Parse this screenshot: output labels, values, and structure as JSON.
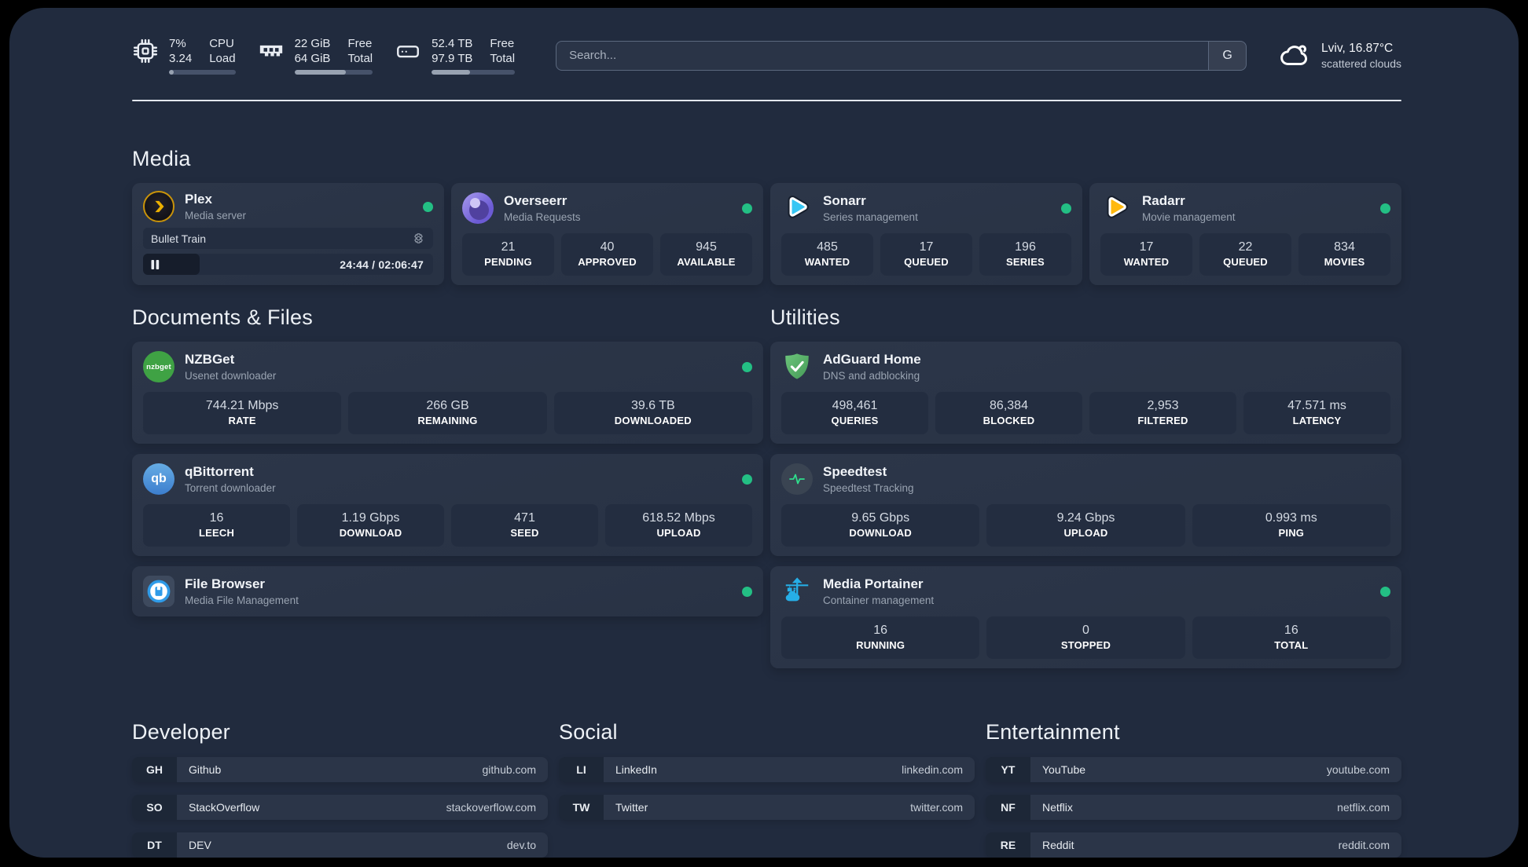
{
  "colors": {
    "page_bg": "#212B3E",
    "card_bg": "#2A3447",
    "status_online": "#23BF84"
  },
  "topbar": {
    "stats": [
      {
        "icon": "cpu-icon",
        "values": [
          "7%",
          "3.24"
        ],
        "labels": [
          "CPU",
          "Load"
        ],
        "progress": "7%"
      },
      {
        "icon": "memory-icon",
        "values": [
          "22 GiB",
          "64 GiB"
        ],
        "labels": [
          "Free",
          "Total"
        ],
        "progress": "66%"
      },
      {
        "icon": "disk-icon",
        "values": [
          "52.4 TB",
          "97.9 TB"
        ],
        "labels": [
          "Free",
          "Total"
        ],
        "progress": "46%"
      }
    ],
    "search": {
      "placeholder": "Search...",
      "engine": "G"
    },
    "weather": {
      "icon": "cloud-icon",
      "summary": "Lviv, 16.87°C",
      "condition": "scattered clouds"
    }
  },
  "media": {
    "title": "Media",
    "plex": {
      "name": "Plex",
      "desc": "Media server",
      "icon": "plex-icon",
      "online": true,
      "now_playing": {
        "title": "Bullet Train",
        "time": "24:44 / 02:06:47",
        "progress": "19.5%"
      }
    },
    "overseerr": {
      "name": "Overseerr",
      "desc": "Media Requests",
      "icon": "overseerr-icon",
      "online": true,
      "stats": [
        {
          "value": "21",
          "label": "PENDING"
        },
        {
          "value": "40",
          "label": "APPROVED"
        },
        {
          "value": "945",
          "label": "AVAILABLE"
        }
      ]
    },
    "sonarr": {
      "name": "Sonarr",
      "desc": "Series management",
      "icon": "sonarr-icon",
      "online": true,
      "stats": [
        {
          "value": "485",
          "label": "WANTED"
        },
        {
          "value": "17",
          "label": "QUEUED"
        },
        {
          "value": "196",
          "label": "SERIES"
        }
      ]
    },
    "radarr": {
      "name": "Radarr",
      "desc": "Movie management",
      "icon": "radarr-icon",
      "online": true,
      "stats": [
        {
          "value": "17",
          "label": "WANTED"
        },
        {
          "value": "22",
          "label": "QUEUED"
        },
        {
          "value": "834",
          "label": "MOVIES"
        }
      ]
    }
  },
  "documents": {
    "title": "Documents & Files",
    "nzbget": {
      "name": "NZBGet",
      "desc": "Usenet downloader",
      "icon": "nzbget-icon",
      "icon_text": "nzbget",
      "online": true,
      "stats": [
        {
          "value": "744.21 Mbps",
          "label": "RATE"
        },
        {
          "value": "266 GB",
          "label": "REMAINING"
        },
        {
          "value": "39.6 TB",
          "label": "DOWNLOADED"
        }
      ]
    },
    "qbittorrent": {
      "name": "qBittorrent",
      "desc": "Torrent downloader",
      "icon": "qbittorrent-icon",
      "icon_text": "qb",
      "online": true,
      "stats": [
        {
          "value": "16",
          "label": "LEECH"
        },
        {
          "value": "1.19 Gbps",
          "label": "DOWNLOAD"
        },
        {
          "value": "471",
          "label": "SEED"
        },
        {
          "value": "618.52 Mbps",
          "label": "UPLOAD"
        }
      ]
    },
    "filebrowser": {
      "name": "File Browser",
      "desc": "Media File Management",
      "icon": "filebrowser-icon",
      "online": true
    }
  },
  "utilities": {
    "title": "Utilities",
    "adguard": {
      "name": "AdGuard Home",
      "desc": "DNS and adblocking",
      "icon": "adguard-icon",
      "stats": [
        {
          "value": "498,461",
          "label": "QUERIES"
        },
        {
          "value": "86,384",
          "label": "BLOCKED"
        },
        {
          "value": "2,953",
          "label": "FILTERED"
        },
        {
          "value": "47.571 ms",
          "label": "LATENCY"
        }
      ]
    },
    "speedtest": {
      "name": "Speedtest",
      "desc": "Speedtest Tracking",
      "icon": "speedtest-icon",
      "stats": [
        {
          "value": "9.65 Gbps",
          "label": "DOWNLOAD"
        },
        {
          "value": "9.24 Gbps",
          "label": "UPLOAD"
        },
        {
          "value": "0.993 ms",
          "label": "PING"
        }
      ]
    },
    "portainer": {
      "name": "Media Portainer",
      "desc": "Container management",
      "icon": "portainer-icon",
      "online": true,
      "stats": [
        {
          "value": "16",
          "label": "RUNNING"
        },
        {
          "value": "0",
          "label": "STOPPED"
        },
        {
          "value": "16",
          "label": "TOTAL"
        }
      ]
    }
  },
  "bookmarks": {
    "developer": {
      "title": "Developer",
      "items": [
        {
          "abbr": "GH",
          "name": "Github",
          "url": "github.com"
        },
        {
          "abbr": "SO",
          "name": "StackOverflow",
          "url": "stackoverflow.com"
        },
        {
          "abbr": "DT",
          "name": "DEV",
          "url": "dev.to"
        }
      ]
    },
    "social": {
      "title": "Social",
      "items": [
        {
          "abbr": "LI",
          "name": "LinkedIn",
          "url": "linkedin.com"
        },
        {
          "abbr": "TW",
          "name": "Twitter",
          "url": "twitter.com"
        }
      ]
    },
    "entertainment": {
      "title": "Entertainment",
      "items": [
        {
          "abbr": "YT",
          "name": "YouTube",
          "url": "youtube.com"
        },
        {
          "abbr": "NF",
          "name": "Netflix",
          "url": "netflix.com"
        },
        {
          "abbr": "RE",
          "name": "Reddit",
          "url": "reddit.com"
        }
      ]
    }
  }
}
